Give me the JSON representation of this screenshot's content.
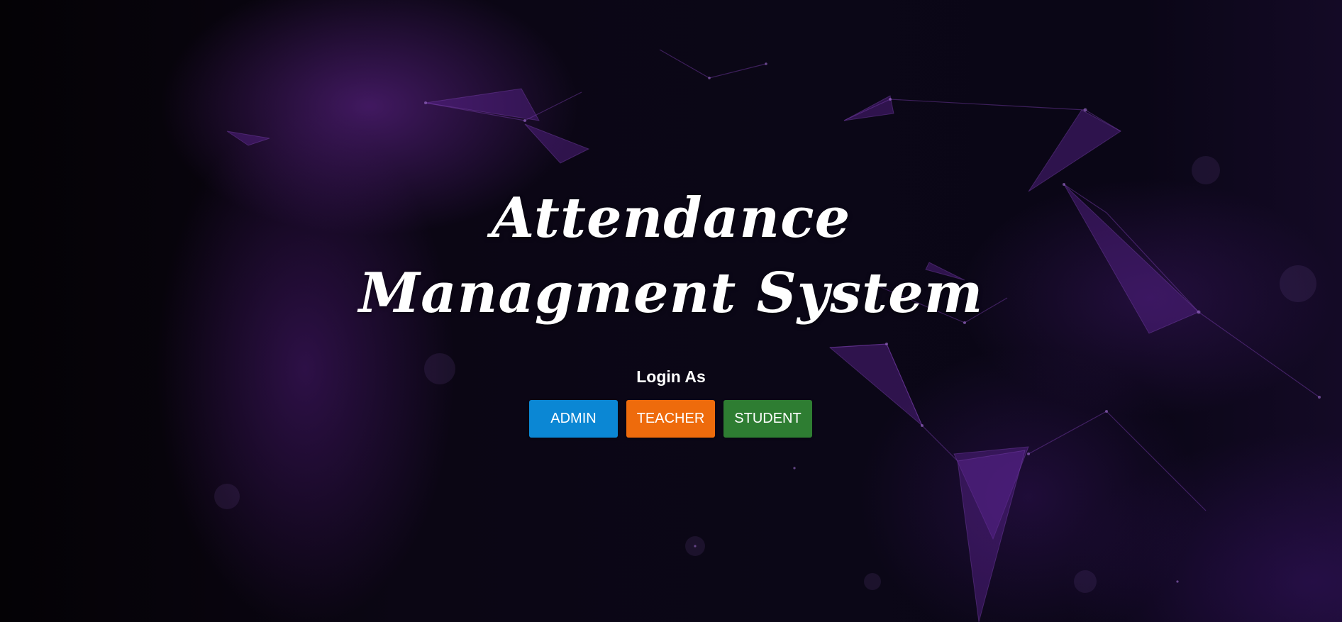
{
  "header": {
    "title": "Attendance Managment System"
  },
  "login": {
    "label": "Login As",
    "buttons": [
      {
        "label": "ADMIN",
        "color": "#0b87d4"
      },
      {
        "label": "TEACHER",
        "color": "#ee6b0c"
      },
      {
        "label": "STUDENT",
        "color": "#2e7d32"
      }
    ]
  },
  "theme": {
    "background": "#07040c",
    "accent_purple": "#6a2aa0",
    "text": "#ffffff"
  },
  "background_art": "purple-plexus-network"
}
